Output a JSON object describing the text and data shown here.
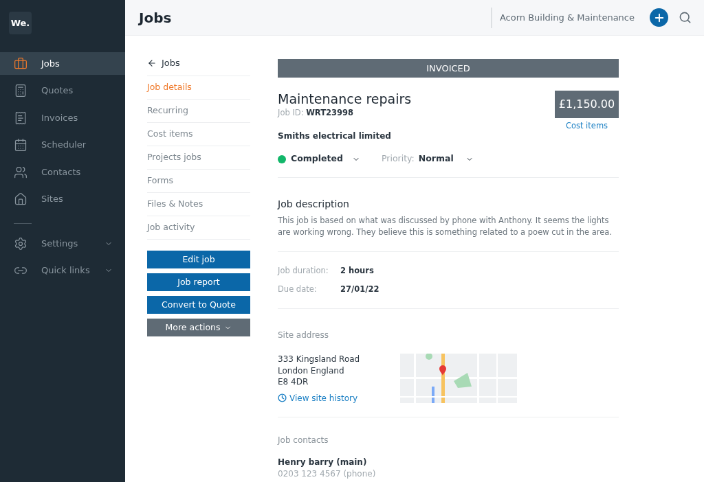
{
  "logo": "We.",
  "sidebar": {
    "items": [
      {
        "label": "Jobs",
        "selected": true
      },
      {
        "label": "Quotes",
        "selected": false
      },
      {
        "label": "Invoices",
        "selected": false
      },
      {
        "label": "Scheduler",
        "selected": false
      },
      {
        "label": "Contacts",
        "selected": false
      },
      {
        "label": "Sites",
        "selected": false
      }
    ],
    "groups": [
      {
        "label": "Settings",
        "expanded": false
      },
      {
        "label": "Quick links",
        "expanded": false
      }
    ]
  },
  "header": {
    "title": "Jobs",
    "company": "Acorn Building & Maintenance"
  },
  "subnav": {
    "back": "Jobs",
    "items": [
      {
        "label": "Job details",
        "selected": true
      },
      {
        "label": "Recurring",
        "selected": false
      },
      {
        "label": "Cost items",
        "selected": false
      },
      {
        "label": "Projects jobs",
        "selected": false
      },
      {
        "label": "Forms",
        "selected": false
      },
      {
        "label": "Files & Notes",
        "selected": false
      },
      {
        "label": "Job activity",
        "selected": false
      }
    ],
    "buttons": [
      {
        "label": "Edit job",
        "kind": "primary"
      },
      {
        "label": "Job report",
        "kind": "primary"
      },
      {
        "label": "Convert to Quote",
        "kind": "primary"
      },
      {
        "label": "More actions",
        "kind": "menu"
      }
    ]
  },
  "job": {
    "status_banner": "INVOICED",
    "title": "Maintenance repairs",
    "id_label": "Job ID:",
    "id": "WRT23998",
    "amount": "£1,150.00",
    "amount_link": "Cost items",
    "customer": "Smiths electrical limited",
    "status": {
      "label": "Completed",
      "color": "#12b76a"
    },
    "priority_label": "Priority:",
    "priority": "Normal",
    "description_title": "Job description",
    "description": "This job is based on what was discussed by phone with Anthony. It seems the lights are working wrong. They believe this is something related to a poew cut in the area.",
    "facts": [
      {
        "label": "Job duration:",
        "value": "2 hours"
      },
      {
        "label": "Due date:",
        "value": "27/01/22"
      }
    ],
    "site_title": "Site address",
    "address": [
      "333 Kingsland Road",
      "London England",
      "E8 4DR"
    ],
    "site_history": "View site history",
    "map": {
      "kind": "picture"
    },
    "contacts_title": "Job contacts",
    "contact_name": "Henry barry (main)",
    "contact_phone": "0203 123 4567 (phone)"
  }
}
